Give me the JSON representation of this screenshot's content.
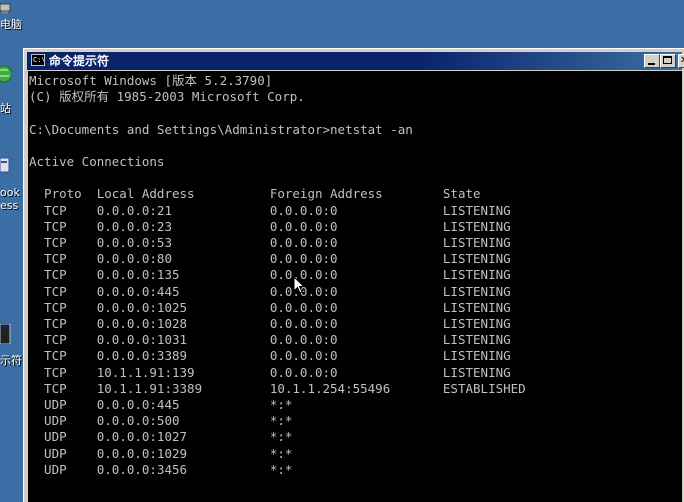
{
  "desktop": {
    "icons": [
      {
        "name": "computer",
        "label": "电脑",
        "color": "#c0c0c0"
      },
      {
        "name": "network",
        "label": "站",
        "color": "#3cae3c"
      },
      {
        "name": "outlook",
        "label": "ook\ness",
        "color": "#e0e0e0"
      },
      {
        "name": "cmd",
        "label": "示符",
        "color": "#202020"
      }
    ]
  },
  "window": {
    "title": "命令提示符",
    "app_icon": "cmd-icon",
    "title_color": "#0a246a",
    "buttons": {
      "minimize": "minimize-icon",
      "maximize": "maximize-icon",
      "close": "close-icon"
    }
  },
  "console": {
    "text_color": "#c0c0c0",
    "background": "#000000",
    "lines": [
      "Microsoft Windows [版本 5.2.3790]",
      "(C) 版权所有 1985-2003 Microsoft Corp.",
      "",
      "C:\\Documents and Settings\\Administrator>netstat -an",
      "",
      "Active Connections",
      "",
      "  Proto  Local Address          Foreign Address        State",
      "  TCP    0.0.0.0:21             0.0.0.0:0              LISTENING",
      "  TCP    0.0.0.0:23             0.0.0.0:0              LISTENING",
      "  TCP    0.0.0.0:53             0.0.0.0:0              LISTENING",
      "  TCP    0.0.0.0:80             0.0.0.0:0              LISTENING",
      "  TCP    0.0.0.0:135            0.0.0.0:0              LISTENING",
      "  TCP    0.0.0.0:445            0.0.0.0:0              LISTENING",
      "  TCP    0.0.0.0:1025           0.0.0.0:0              LISTENING",
      "  TCP    0.0.0.0:1028           0.0.0.0:0              LISTENING",
      "  TCP    0.0.0.0:1031           0.0.0.0:0              LISTENING",
      "  TCP    0.0.0.0:3389           0.0.0.0:0              LISTENING",
      "  TCP    10.1.1.91:139          0.0.0.0:0              LISTENING",
      "  TCP    10.1.1.91:3389         10.1.1.254:55496       ESTABLISHED",
      "  UDP    0.0.0.0:445            *:*",
      "  UDP    0.0.0.0:500            *:*",
      "  UDP    0.0.0.0:1027           *:*",
      "  UDP    0.0.0.0:1029           *:*",
      "  UDP    0.0.0.0:3456           *:*"
    ]
  },
  "pointer": "arrow-cursor-icon"
}
